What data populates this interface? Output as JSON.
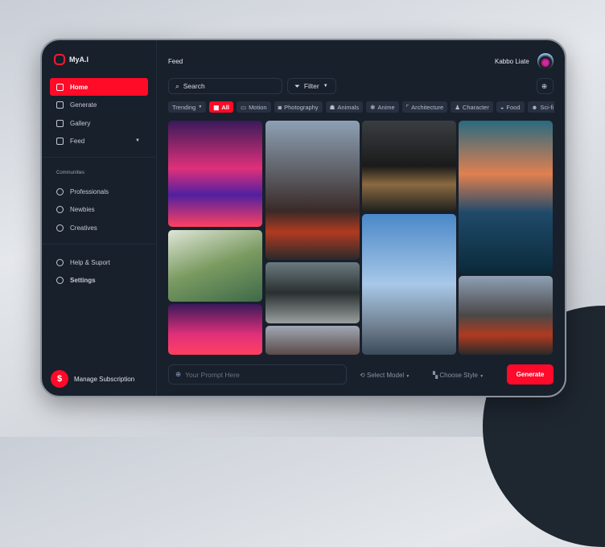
{
  "app": {
    "name": "MyA.I"
  },
  "sidebar": {
    "items": [
      {
        "label": "Home"
      },
      {
        "label": "Generate"
      },
      {
        "label": "Gallery"
      },
      {
        "label": "Feed"
      }
    ],
    "communities_title": "Communities",
    "communities": [
      {
        "label": "Professionals"
      },
      {
        "label": "Newbies"
      },
      {
        "label": "Creatives"
      }
    ],
    "bottom": [
      {
        "label": "Help & Suport"
      },
      {
        "label": "Settings"
      }
    ],
    "manage": "Manage Subscription"
  },
  "header": {
    "title": "Feed",
    "user": "Kabbo Liate"
  },
  "search": {
    "placeholder": "Search"
  },
  "filter": {
    "label": "Filter"
  },
  "sort": {
    "label": "Trending"
  },
  "categories": [
    {
      "label": "All"
    },
    {
      "label": "Motion"
    },
    {
      "label": "Photography"
    },
    {
      "label": "Animals"
    },
    {
      "label": "Anime"
    },
    {
      "label": "Architecture"
    },
    {
      "label": "Character"
    },
    {
      "label": "Food"
    },
    {
      "label": "Sci-fi"
    }
  ],
  "prompt": {
    "placeholder": "Your Prompt Here",
    "model": "Select Model",
    "style": "Choose Style",
    "generate": "Generate"
  },
  "colors": {
    "accent": "#ff0a27",
    "bg": "#18202c"
  }
}
